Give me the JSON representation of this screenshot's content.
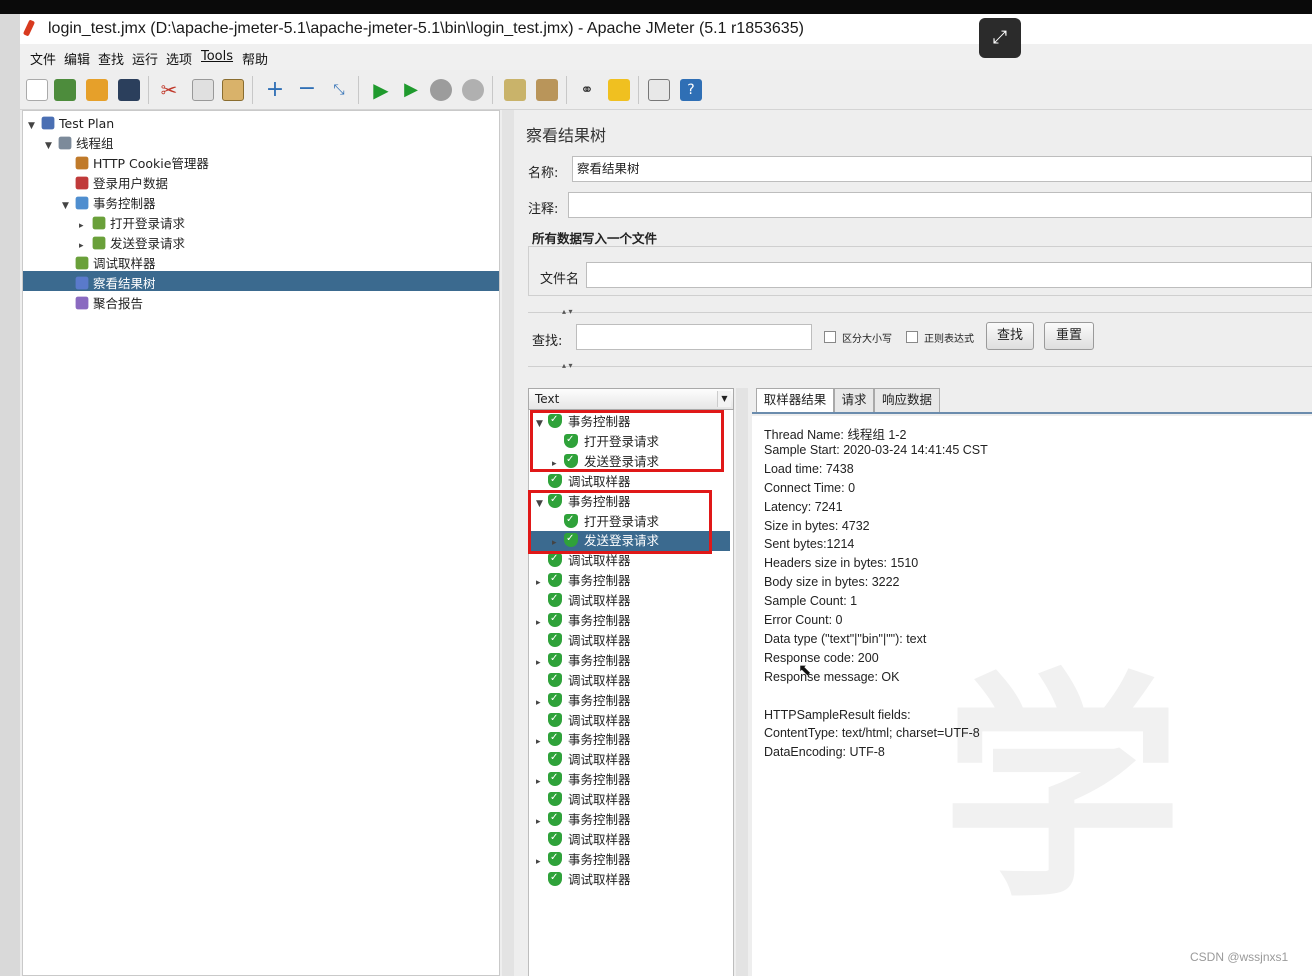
{
  "window": {
    "title": "login_test.jmx (D:\\apache-jmeter-5.1\\apache-jmeter-5.1\\bin\\login_test.jmx) - Apache JMeter (5.1 r1853635)"
  },
  "menu": [
    "文件",
    "编辑",
    "查找",
    "运行",
    "选项",
    "Tools",
    "帮助"
  ],
  "toolbar": {
    "icons": [
      "new-icon",
      "templates-icon",
      "open-icon",
      "save-icon",
      "cut-icon",
      "copy-icon",
      "paste-icon",
      "expand-icon",
      "collapse-icon",
      "toggle-icon",
      "start-icon",
      "start-no-pause-icon",
      "stop-icon",
      "shutdown-icon",
      "clear-icon",
      "clear-all-icon",
      "search-icon",
      "reset-search-icon",
      "function-helper-icon",
      "help-icon"
    ]
  },
  "tree": [
    {
      "label": "Test Plan",
      "level": 0,
      "toggle": "▼",
      "icon": "test-plan-icon"
    },
    {
      "label": "线程组",
      "level": 1,
      "toggle": "▼",
      "icon": "thread-group-icon"
    },
    {
      "label": "HTTP Cookie管理器",
      "level": 2,
      "toggle": "",
      "icon": "cookie-manager-icon"
    },
    {
      "label": "登录用户数据",
      "level": 2,
      "toggle": "",
      "icon": "csv-data-icon"
    },
    {
      "label": "事务控制器",
      "level": 2,
      "toggle": "▼",
      "icon": "transaction-controller-icon"
    },
    {
      "label": "打开登录请求",
      "level": 3,
      "toggle": "▸",
      "icon": "sampler-icon"
    },
    {
      "label": "发送登录请求",
      "level": 3,
      "toggle": "▸",
      "icon": "sampler-icon"
    },
    {
      "label": "调试取样器",
      "level": 2,
      "toggle": "",
      "icon": "debug-sampler-icon"
    },
    {
      "label": "察看结果树",
      "level": 2,
      "toggle": "",
      "icon": "results-tree-icon"
    },
    {
      "label": "聚合报告",
      "level": 2,
      "toggle": "",
      "icon": "aggregate-report-icon"
    }
  ],
  "panel": {
    "title": "察看结果树",
    "name_label": "名称:",
    "name_value": "察看结果树",
    "comment_label": "注释:",
    "comment_value": "",
    "file_group_title": "所有数据写入一个文件",
    "filename_label": "文件名",
    "filename_value": "",
    "search_label": "查找:",
    "search_value": "",
    "case_sensitive_label": "区分大小写",
    "regex_label": "正则表达式",
    "find_button": "查找",
    "reset_button": "重置"
  },
  "renderer": {
    "selected": "Text"
  },
  "results": [
    {
      "label": "事务控制器",
      "indent": 0,
      "toggle": "▼"
    },
    {
      "label": "打开登录请求",
      "indent": 1,
      "toggle": ""
    },
    {
      "label": "发送登录请求",
      "indent": 1,
      "toggle": "▸"
    },
    {
      "label": "调试取样器",
      "indent": 0,
      "toggle": ""
    },
    {
      "label": "事务控制器",
      "indent": 0,
      "toggle": "▼"
    },
    {
      "label": "打开登录请求",
      "indent": 1,
      "toggle": ""
    },
    {
      "label": "发送登录请求",
      "indent": 1,
      "toggle": "▸"
    },
    {
      "label": "调试取样器",
      "indent": 0,
      "toggle": ""
    },
    {
      "label": "事务控制器",
      "indent": 0,
      "toggle": "▸"
    },
    {
      "label": "调试取样器",
      "indent": 0,
      "toggle": ""
    },
    {
      "label": "事务控制器",
      "indent": 0,
      "toggle": "▸"
    },
    {
      "label": "调试取样器",
      "indent": 0,
      "toggle": ""
    },
    {
      "label": "事务控制器",
      "indent": 0,
      "toggle": "▸"
    },
    {
      "label": "调试取样器",
      "indent": 0,
      "toggle": ""
    },
    {
      "label": "事务控制器",
      "indent": 0,
      "toggle": "▸"
    },
    {
      "label": "调试取样器",
      "indent": 0,
      "toggle": ""
    },
    {
      "label": "事务控制器",
      "indent": 0,
      "toggle": "▸"
    },
    {
      "label": "调试取样器",
      "indent": 0,
      "toggle": ""
    },
    {
      "label": "事务控制器",
      "indent": 0,
      "toggle": "▸"
    },
    {
      "label": "调试取样器",
      "indent": 0,
      "toggle": ""
    },
    {
      "label": "事务控制器",
      "indent": 0,
      "toggle": "▸"
    },
    {
      "label": "调试取样器",
      "indent": 0,
      "toggle": ""
    },
    {
      "label": "事务控制器",
      "indent": 0,
      "toggle": "▸"
    },
    {
      "label": "调试取样器",
      "indent": 0,
      "toggle": ""
    }
  ],
  "tabs": [
    "取样器结果",
    "请求",
    "响应数据"
  ],
  "sample_result": [
    "Thread Name: 线程组 1-2",
    "Sample Start: 2020-03-24 14:41:45 CST",
    "Load time: 7438",
    "Connect Time: 0",
    "Latency: 7241",
    "Size in bytes: 4732",
    "Sent bytes:1214",
    "Headers size in bytes: 1510",
    "Body size in bytes: 3222",
    "Sample Count: 1",
    "Error Count: 0",
    "Data type (\"text\"|\"bin\"|\"\"): text",
    "Response code: 200",
    "Response message: OK",
    "",
    "HTTPSampleResult fields:",
    "ContentType: text/html; charset=UTF-8",
    "DataEncoding: UTF-8"
  ],
  "watermark_text": "学",
  "credit": "CSDN @wssjnxs1"
}
